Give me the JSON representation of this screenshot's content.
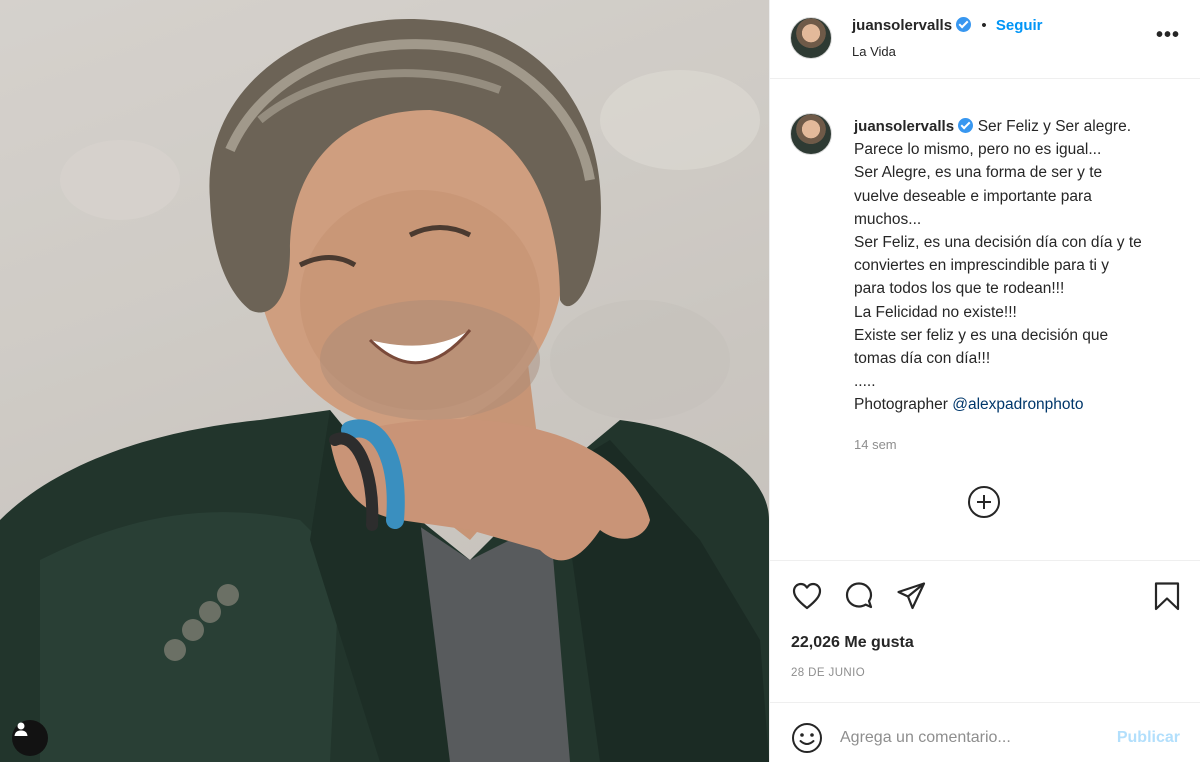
{
  "post": {
    "image": {
      "description": "portrait photo",
      "background_colors": [
        "#d9d6d1",
        "#bdb8b1"
      ],
      "tag_icon": "user-tag-icon"
    },
    "header": {
      "username": "juansolervalls",
      "verified": true,
      "separator": "•",
      "follow_label": "Seguir",
      "location": "La Vida",
      "more_icon": "more-options-icon",
      "more_label": "•••"
    },
    "caption": {
      "username": "juansolervalls",
      "lines": [
        "Ser Feliz y Ser alegre.",
        "Parece lo mismo, pero no es igual...",
        "Ser Alegre, es una forma de ser y te",
        "vuelve deseable e importante para",
        "muchos...",
        "Ser Feliz, es una decisión día con día y te",
        "conviertes en imprescindible para ti y",
        "para todos los que te rodean!!!",
        "La Felicidad no existe!!!",
        "Existe ser feliz y es una decisión que",
        "tomas día con día!!!",
        "....."
      ],
      "photographer_prefix": "Photographer ",
      "photographer_mention": "@alexpadronphoto",
      "time_ago": "14 sem"
    },
    "load_more_icon": "plus-circle-icon",
    "actions": {
      "like_icon": "heart-icon",
      "comment_icon": "comment-icon",
      "share_icon": "paper-plane-icon",
      "save_icon": "bookmark-icon"
    },
    "likes_text": "22,026 Me gusta",
    "date": "28 DE JUNIO",
    "comment_box": {
      "emoji_icon": "emoji-icon",
      "placeholder": "Agrega un comentario...",
      "publish_label": "Publicar"
    },
    "colors": {
      "accent": "#0095f6",
      "mention": "#00376b",
      "publish_disabled": "#b2dffc",
      "verified": "#3897f0",
      "muted": "#8e8e8e"
    }
  }
}
